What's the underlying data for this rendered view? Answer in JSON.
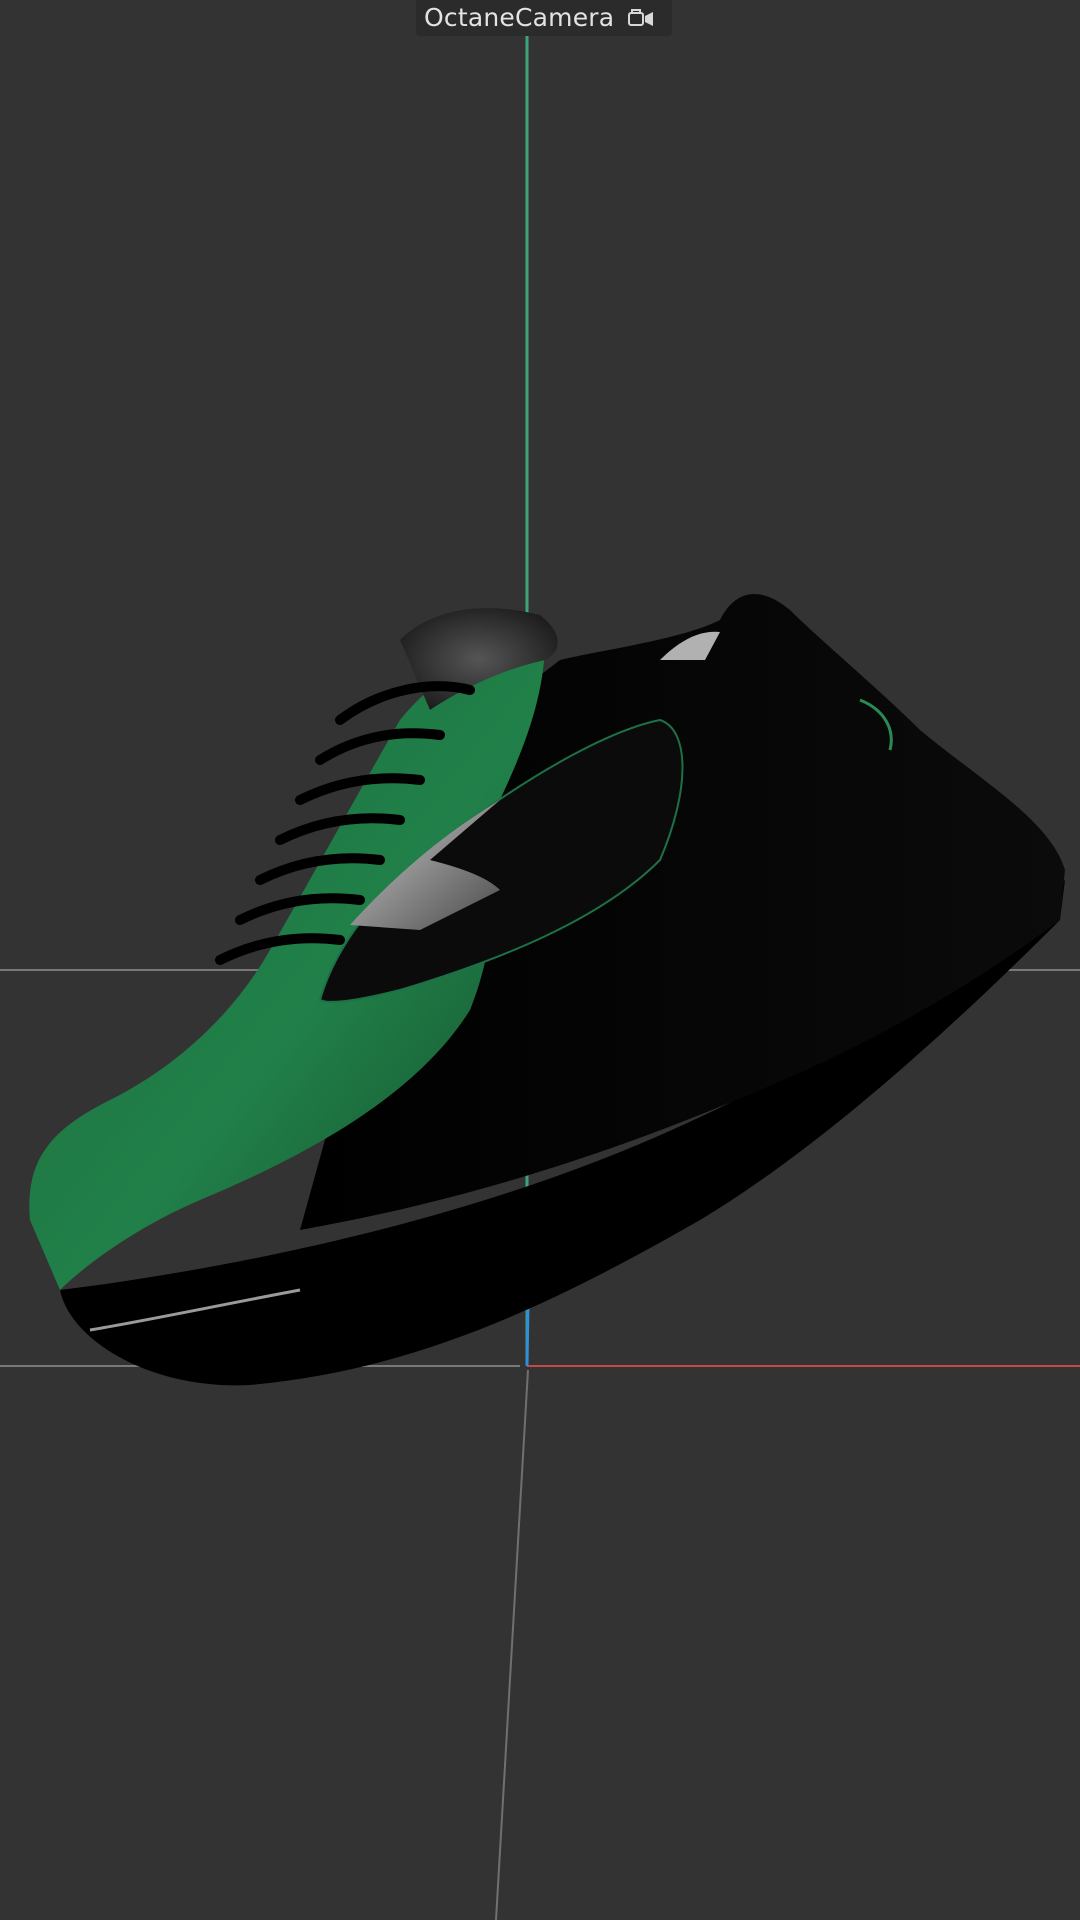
{
  "viewport": {
    "camera_name": "OctaneCamera",
    "camera_icon": "camera-lock-icon",
    "background_color": "#333333",
    "axis_colors": {
      "x_axis": "#c24a4a",
      "y_axis": "#3fa37a",
      "z_axis": "#2f8fd8",
      "grid": "#8a8a8a"
    },
    "object": {
      "name": "sneaker-model",
      "primary_color": "#1f7a43",
      "secondary_color": "#050505",
      "accent_color": "#8a8a8a"
    }
  }
}
